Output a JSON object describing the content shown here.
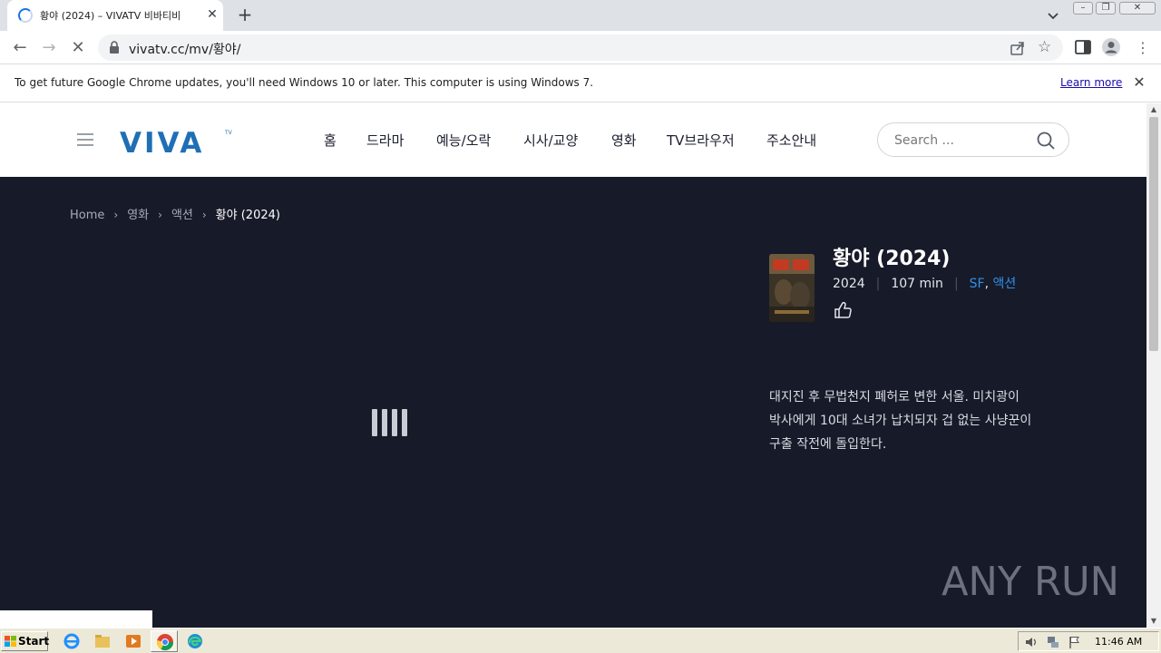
{
  "browser": {
    "tab_title": "황야 (2024) – VIVATV 비바티비",
    "url": "vivatv.cc/mv/황야/",
    "infobar_message": "To get future Google Chrome updates, you'll need Windows 10 or later. This computer is using Windows 7.",
    "infobar_link": "Learn more"
  },
  "site": {
    "logo_text": "VIVA",
    "logo_superscript": "TV",
    "nav": [
      "홈",
      "드라마",
      "예능/오락",
      "시사/교양",
      "영화",
      "TV브라우저",
      "주소안내"
    ],
    "search_placeholder": "Search ..."
  },
  "breadcrumb": [
    "Home",
    "영화",
    "액션",
    "황야 (2024)"
  ],
  "movie": {
    "title": "황야 (2024)",
    "year": "2024",
    "runtime": "107 min",
    "genres": [
      "SF",
      "액션"
    ],
    "synopsis": "대지진 후 무법천지 폐허로 변한 서울. 미치광이 박사에게 10대 소녀가 납치되자 겁 없는 사냥꾼이 구출 작전에 돌입한다."
  },
  "watermark": "ANY RUN",
  "taskbar": {
    "start_label": "Start",
    "clock": "11:46 AM"
  },
  "colors": {
    "content_bg": "#171a28",
    "accent_link": "#2f8fe8",
    "logo_blue": "#1f6fb5"
  }
}
